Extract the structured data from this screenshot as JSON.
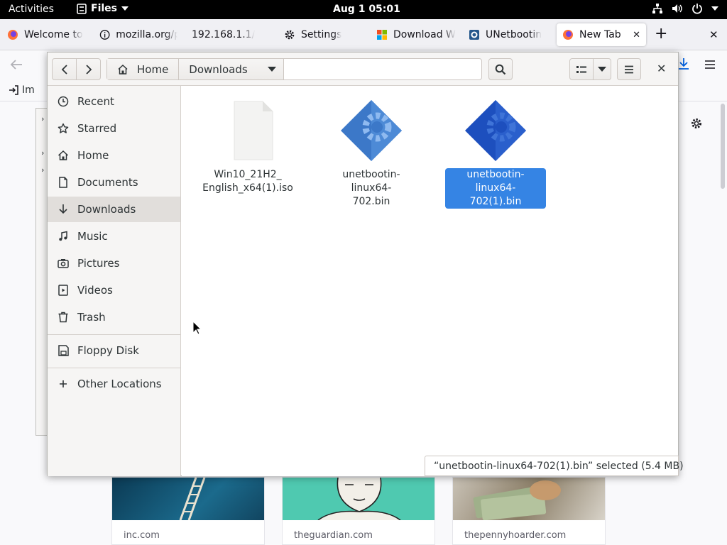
{
  "topbar": {
    "activities": "Activities",
    "app_name": "Files",
    "clock": "Aug 1  05:01"
  },
  "browser": {
    "tabs": [
      {
        "label": "Welcome to"
      },
      {
        "label": "mozilla.org/p"
      },
      {
        "label": "192.168.1.1/"
      },
      {
        "label": "Settings"
      },
      {
        "label": "Download W"
      },
      {
        "label": "UNetbootin"
      },
      {
        "label": "New Tab"
      }
    ],
    "bookmark_label": "Im",
    "tiles": [
      {
        "site": "inc.com"
      },
      {
        "site": "theguardian.com"
      },
      {
        "site": "thepennyhoarder.com"
      }
    ]
  },
  "chooser": {
    "path": {
      "home": "Home",
      "current": "Downloads"
    },
    "sidebar": [
      {
        "label": "Recent",
        "icon": "clock-icon"
      },
      {
        "label": "Starred",
        "icon": "star-icon"
      },
      {
        "label": "Home",
        "icon": "home-icon"
      },
      {
        "label": "Documents",
        "icon": "document-icon"
      },
      {
        "label": "Downloads",
        "icon": "download-icon"
      },
      {
        "label": "Music",
        "icon": "music-icon"
      },
      {
        "label": "Pictures",
        "icon": "camera-icon"
      },
      {
        "label": "Videos",
        "icon": "video-icon"
      },
      {
        "label": "Trash",
        "icon": "trash-icon"
      },
      {
        "label": "Floppy Disk",
        "icon": "floppy-icon"
      },
      {
        "label": "Other Locations",
        "icon": "plus-icon"
      }
    ],
    "files": [
      {
        "name_line1": "Win10_21H2_",
        "name_line2": "English_x64(1).iso",
        "icon": "generic-file-icon"
      },
      {
        "name_line1": "unetbootin-linux64-",
        "name_line2": "702.bin",
        "icon": "executable-gear-icon"
      },
      {
        "name_line1": "unetbootin-linux64-",
        "name_line2": "702(1).bin",
        "icon": "executable-gear-icon"
      }
    ],
    "status": "“unetbootin-linux64-702(1).bin” selected  (5.4 MB)"
  },
  "colors": {
    "selection": "#3584e4",
    "sidebar_bg": "#f6f5f4",
    "topbar_bg": "#000000"
  }
}
